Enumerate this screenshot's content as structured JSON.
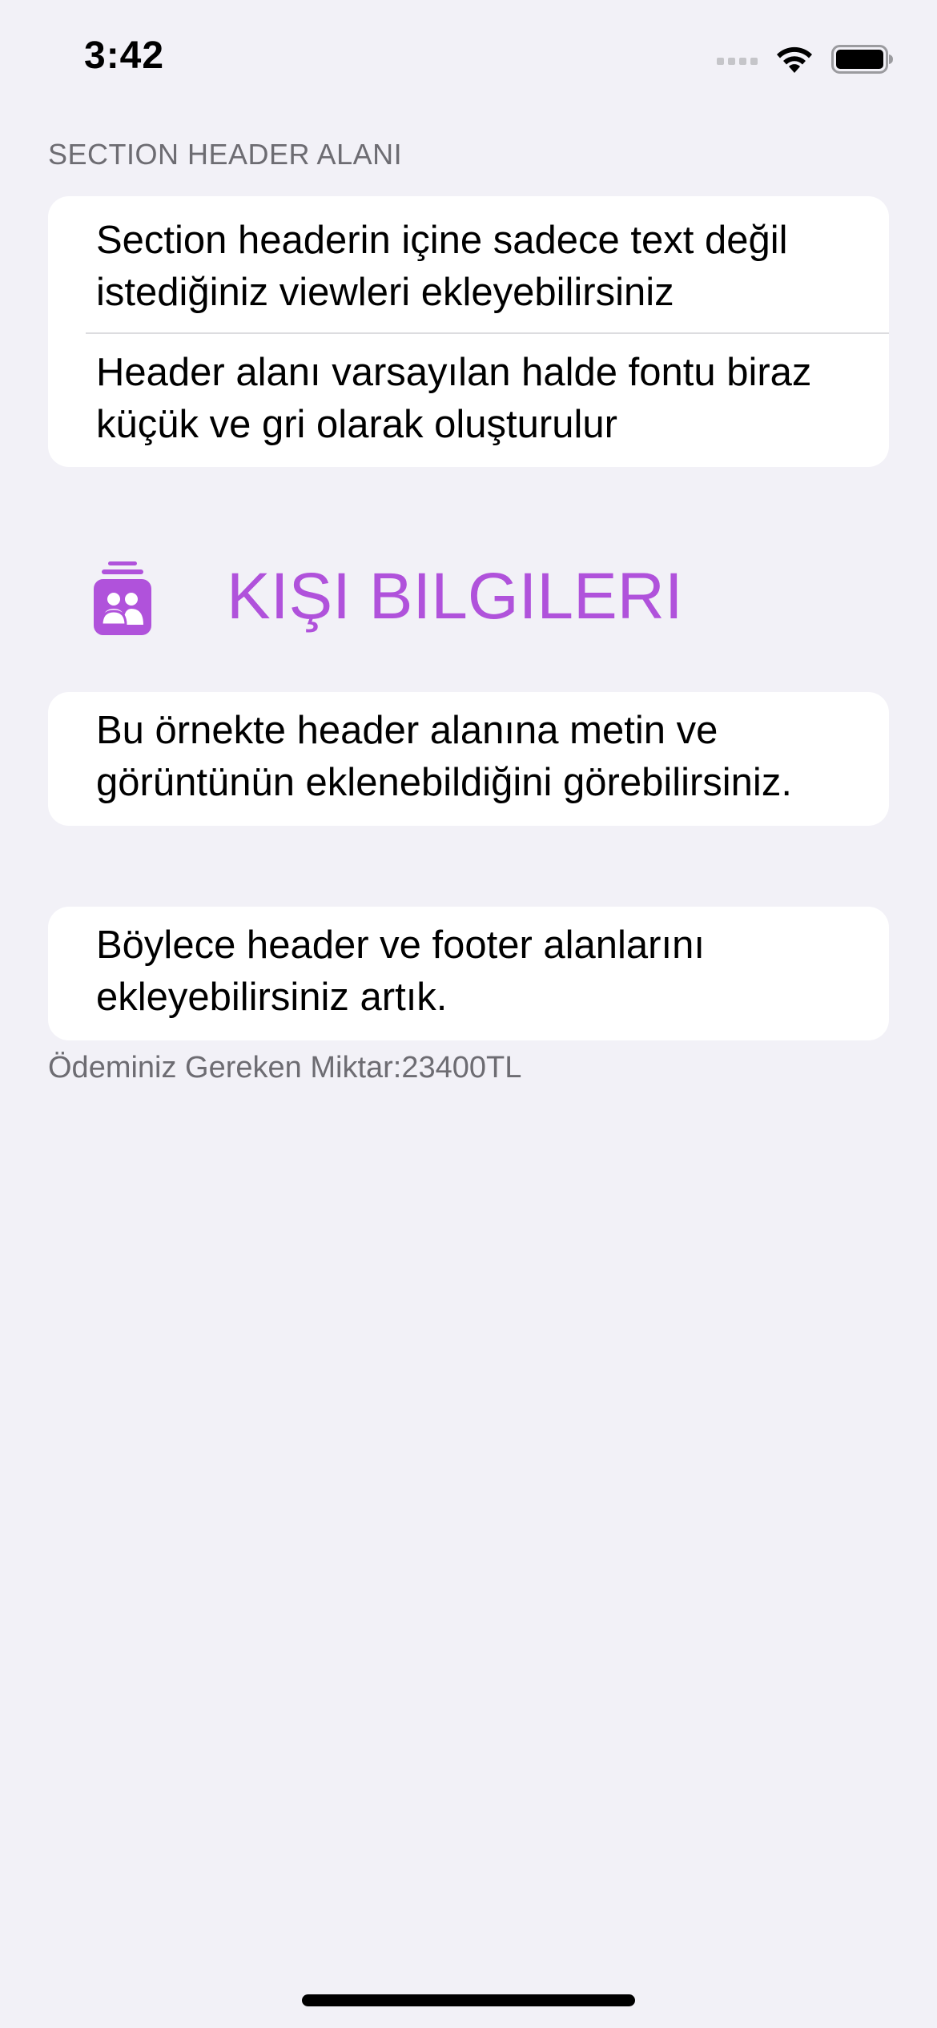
{
  "status_bar": {
    "time": "3:42",
    "signal_icon": "cellular-signal-icon",
    "wifi_icon": "wifi-icon",
    "battery_icon": "battery-icon"
  },
  "section1": {
    "header": "SECTION HEADER ALANI",
    "rows": [
      {
        "line1": "Section headerin içine sadece text değil",
        "line2": "istediğiniz viewleri ekleyebilirsiniz"
      },
      {
        "line1": "Header alanı varsayılan halde fontu biraz",
        "line2": "küçük ve gri olarak oluşturulur"
      }
    ]
  },
  "section2": {
    "header_icon": "person-group-stack-icon",
    "header_title": "KIŞI BILGILERI",
    "accent_color": "#b052db",
    "rows": [
      {
        "line1": "Bu örnekte header alanına metin ve",
        "line2": "görüntünün eklenebildiğini görebilirsiniz."
      }
    ]
  },
  "section3": {
    "rows": [
      {
        "line1": "Böylece header ve footer alanlarını",
        "line2": "ekleyebilirsiniz artık."
      }
    ],
    "footer": "Ödeminiz Gereken Miktar:23400TL"
  }
}
